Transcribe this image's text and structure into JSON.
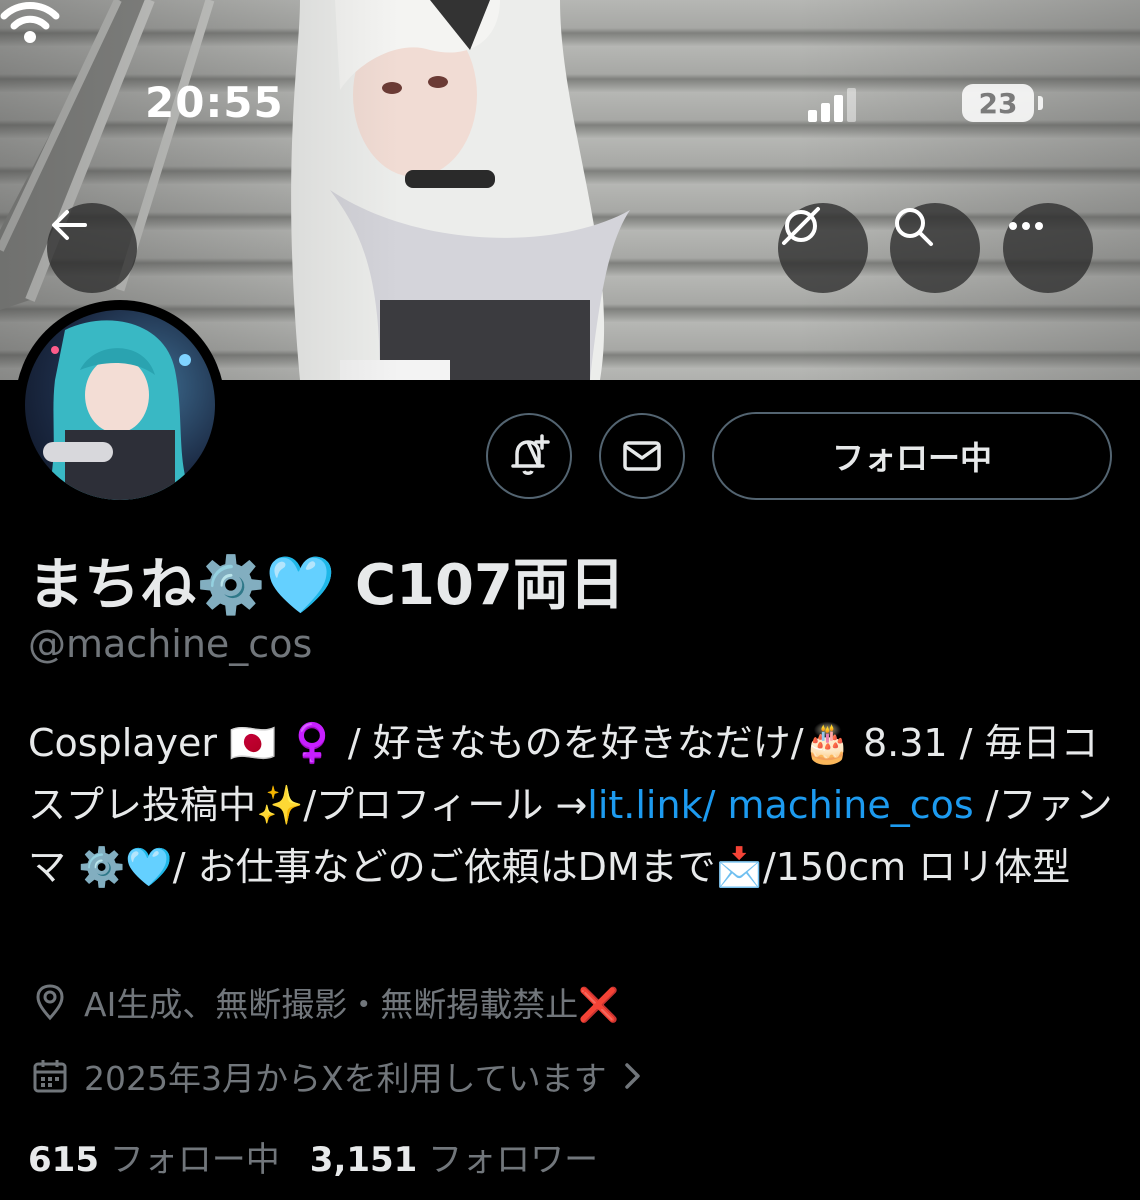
{
  "status_bar": {
    "time": "20:55",
    "battery": "23"
  },
  "profile": {
    "display_name": "まちね⚙️🩵 C107両日",
    "handle": "@machine_cos",
    "follow_button": "フォロー中",
    "bio": {
      "part1": "Cosplayer 🇯🇵 ♀️ / 好きなものを好きなだけ/🎂 8.31 / 毎日コスプレ投稿中✨/プロフィール →",
      "link": "lit.link/ machine_cos",
      "part2": " /ファンマ ⚙️🩵/ お仕事などのご依頼はDMまで📩/150cm ロリ体型"
    },
    "location": "AI生成、無断撮影・無断掲載禁止❌",
    "joined": "2025年3月からXを利用しています",
    "following_count": "615",
    "following_label": "フォロー中",
    "followers_count": "3,151",
    "followers_label": "フォロワー"
  },
  "colors": {
    "link": "#1d9bf0",
    "muted": "#71767b",
    "text": "#e7e9ea",
    "border": "#536471"
  }
}
